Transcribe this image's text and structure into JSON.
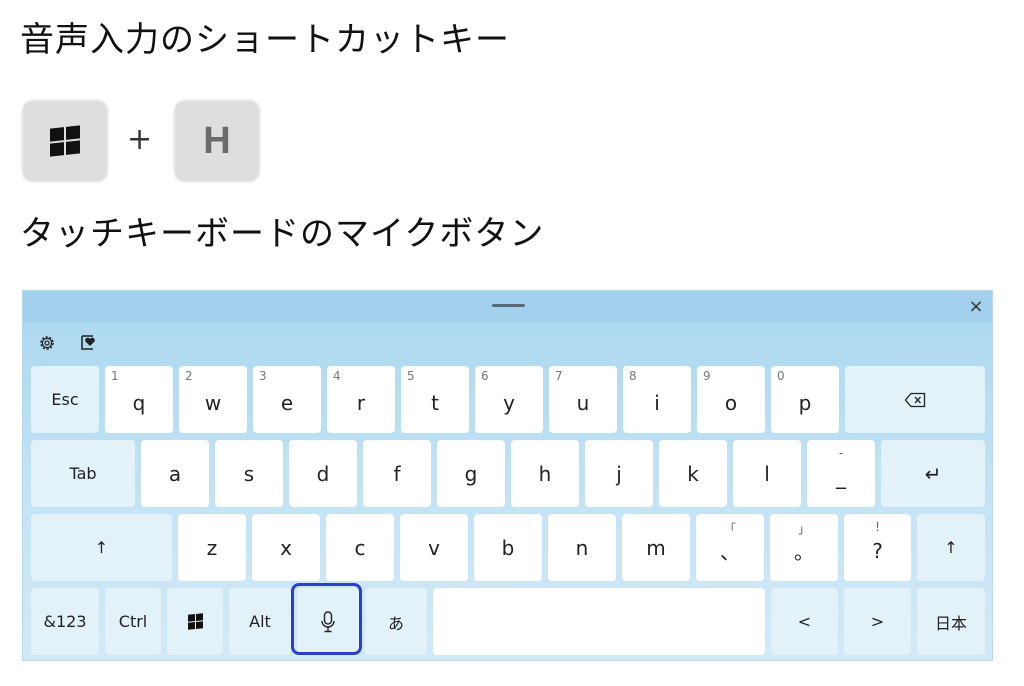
{
  "headings": {
    "shortcut": "音声入力のショートカットキー",
    "touch_mic": "タッチキーボードのマイクボタン"
  },
  "shortcut_combo": {
    "key1_icon": "windows-logo-icon",
    "plus": "+",
    "key2": "H"
  },
  "keyboard": {
    "close": "×",
    "toolbar": {
      "settings_icon": "gear-icon",
      "favorite_icon": "clipboard-heart-icon"
    },
    "row1": {
      "esc": "Esc",
      "keys": [
        {
          "num": "1",
          "label": "q"
        },
        {
          "num": "2",
          "label": "w"
        },
        {
          "num": "3",
          "label": "e"
        },
        {
          "num": "4",
          "label": "r"
        },
        {
          "num": "5",
          "label": "t"
        },
        {
          "num": "6",
          "label": "y"
        },
        {
          "num": "7",
          "label": "u"
        },
        {
          "num": "8",
          "label": "i"
        },
        {
          "num": "9",
          "label": "o"
        },
        {
          "num": "0",
          "label": "p"
        }
      ],
      "backspace_icon": "backspace-icon"
    },
    "row2": {
      "tab": "Tab",
      "keys": [
        "a",
        "s",
        "d",
        "f",
        "g",
        "h",
        "j",
        "k",
        "l"
      ],
      "dash_sup": "-",
      "dash": "_",
      "enter": "↵"
    },
    "row3": {
      "shift_left": "↑",
      "keys": [
        "z",
        "x",
        "c",
        "v",
        "b",
        "n",
        "m"
      ],
      "comma_sup": "「",
      "comma": "、",
      "period_sup": "」",
      "period": "。",
      "question_sup": "!",
      "question": "?",
      "shift_right": "↑"
    },
    "row4": {
      "num_sym": "&123",
      "ctrl": "Ctrl",
      "win_icon": "windows-logo-icon",
      "alt": "Alt",
      "mic_icon": "microphone-icon",
      "kana": "あ",
      "left": "<",
      "right": ">",
      "lang": "日本"
    }
  },
  "colors": {
    "mic_highlight": "#2c3fcb",
    "keyboard_bg": "#b7def2"
  }
}
